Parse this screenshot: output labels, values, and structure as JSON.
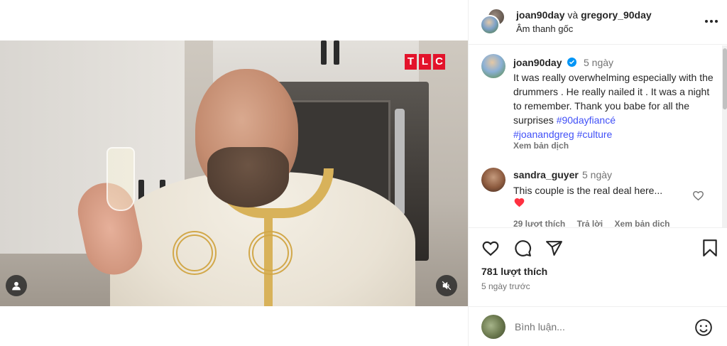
{
  "header": {
    "author_primary": "joan90day",
    "conjunction": "và",
    "author_secondary": "gregory_90day",
    "audio": "Âm thanh gốc"
  },
  "video": {
    "channel_logo": [
      "T",
      "L",
      "C"
    ],
    "muted": true
  },
  "caption": {
    "username": "joan90day",
    "verified": true,
    "time": "5 ngày",
    "text": "It was really overwhelming especially with the drummers . He really nailed it . It was a night to remember. Thank you babe for all the surprises ",
    "hashtags": [
      "#90dayfiancé",
      "#joanandgreg",
      "#culture"
    ],
    "translate_label": "Xem bản dịch"
  },
  "comments": [
    {
      "username": "sandra_guyer",
      "time": "5 ngày",
      "text": "This couple is the real deal here...",
      "emoji": "❤️",
      "likes_label": "29 lượt thích",
      "reply_label": "Trả lời",
      "translate_label": "Xem bản dịch"
    }
  ],
  "actions": {
    "likes_count": "781 lượt thích",
    "posted_ago": "5 ngày trước"
  },
  "composer": {
    "placeholder": "Bình luận..."
  },
  "colors": {
    "tlc_red": "#e3132b",
    "verified_blue": "#0095f6",
    "hashtag": "#4150f7",
    "heart_red": "#ff3040"
  },
  "icons": [
    "more-options-icon",
    "verified-badge-icon",
    "heart-icon",
    "comment-icon",
    "share-icon",
    "bookmark-icon",
    "emoji-icon",
    "user-tag-icon",
    "mute-icon"
  ]
}
